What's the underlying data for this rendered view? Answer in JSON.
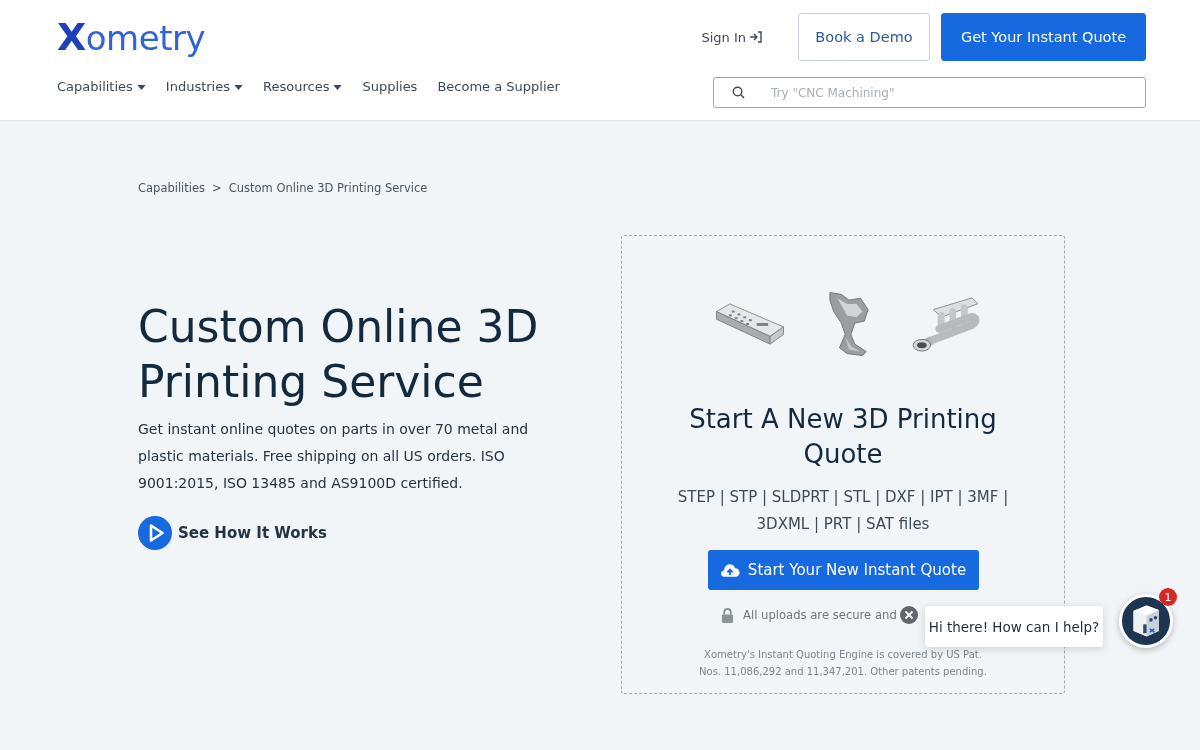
{
  "header": {
    "logo": "Xometry",
    "nav": [
      {
        "label": "Capabilities",
        "dropdown": true
      },
      {
        "label": "Industries",
        "dropdown": true
      },
      {
        "label": "Resources",
        "dropdown": true
      },
      {
        "label": "Supplies",
        "dropdown": false
      },
      {
        "label": "Become a Supplier",
        "dropdown": false
      }
    ],
    "sign_in": "Sign In",
    "buttons": [
      {
        "label": "Book a Demo",
        "kind": "outline"
      },
      {
        "label": "Get Your Instant Quote",
        "kind": "primary"
      }
    ],
    "search": {
      "placeholder": "Try \"CNC Machining\""
    }
  },
  "breadcrumb": {
    "items": [
      "Capabilities",
      "Custom Online 3D Printing Service"
    ],
    "separator": ">"
  },
  "hero": {
    "title": "Custom Online 3D Printing Service",
    "description": "Get instant online quotes on parts in over 70 metal and plastic materials. Free shipping on all US orders. ISO 9001:2015, ISO 13485 and AS9100D certified.",
    "video_link": "See How It Works"
  },
  "quote_panel": {
    "title": "Start A New 3D Printing Quote",
    "file_types": "STEP | STP | SLDPRT | STL | DXF | IPT | 3MF | 3DXML | PRT | SAT files",
    "button": "Start Your New Instant Quote",
    "security_note": "All uploads are secure and",
    "patent_note": "Xometry's Instant Quoting Engine is covered by US Pat. Nos. 11,086,292 and 11,347,201. Other patents pending."
  },
  "chat": {
    "message": "Hi there! How can I help?",
    "badge": "1"
  }
}
